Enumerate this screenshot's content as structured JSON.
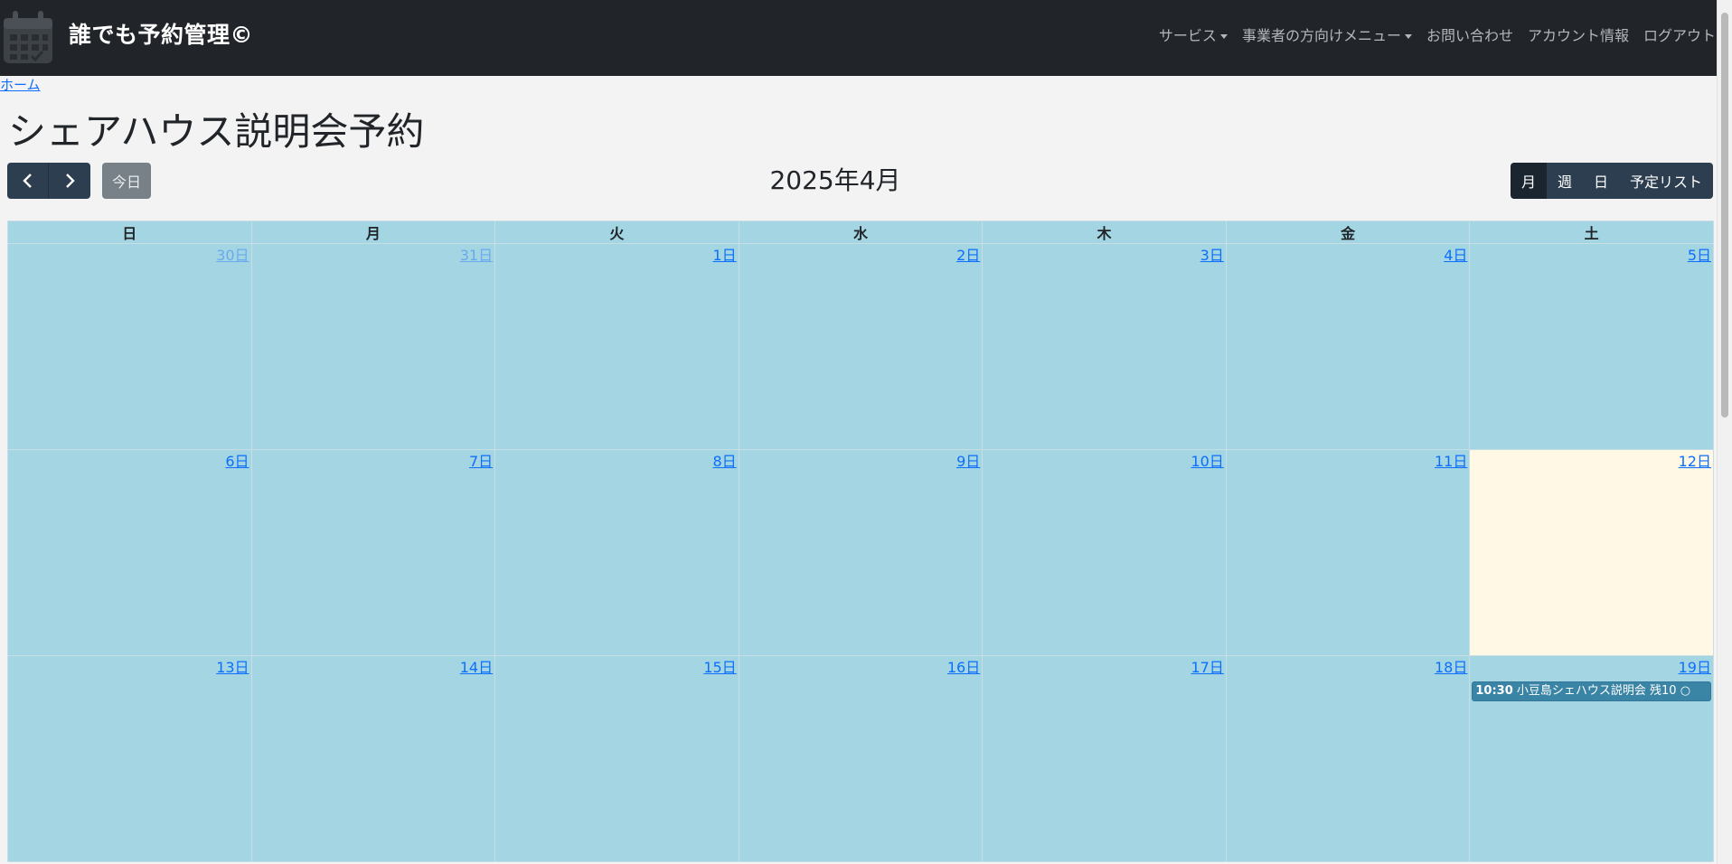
{
  "app": {
    "title": "誰でも予約管理©"
  },
  "nav": {
    "items": [
      {
        "label": "サービス",
        "dropdown": true
      },
      {
        "label": "事業者の方向けメニュー",
        "dropdown": true
      },
      {
        "label": "お問い合わせ",
        "dropdown": false
      },
      {
        "label": "アカウント情報",
        "dropdown": false
      },
      {
        "label": "ログアウト",
        "dropdown": false
      }
    ]
  },
  "breadcrumb": {
    "home": "ホーム"
  },
  "page": {
    "title": "シェアハウス説明会予約"
  },
  "toolbar": {
    "prev_icon": "chevron-left-icon",
    "next_icon": "chevron-right-icon",
    "today_label": "今日",
    "calendar_title": "2025年4月",
    "views": [
      "月",
      "週",
      "日",
      "予定リスト"
    ],
    "active_view": "月"
  },
  "calendar": {
    "weekdays": [
      "日",
      "月",
      "火",
      "水",
      "木",
      "金",
      "土"
    ],
    "weeks": [
      [
        {
          "label": "30日",
          "other": true
        },
        {
          "label": "31日",
          "other": true
        },
        {
          "label": "1日"
        },
        {
          "label": "2日"
        },
        {
          "label": "3日"
        },
        {
          "label": "4日"
        },
        {
          "label": "5日"
        }
      ],
      [
        {
          "label": "6日"
        },
        {
          "label": "7日"
        },
        {
          "label": "8日"
        },
        {
          "label": "9日"
        },
        {
          "label": "10日"
        },
        {
          "label": "11日"
        },
        {
          "label": "12日",
          "today": true
        }
      ],
      [
        {
          "label": "13日"
        },
        {
          "label": "14日"
        },
        {
          "label": "15日"
        },
        {
          "label": "16日"
        },
        {
          "label": "17日"
        },
        {
          "label": "18日"
        },
        {
          "label": "19日",
          "events": [
            {
              "time": "10:30",
              "title": "小豆島シェハウス説明会 残10 ○"
            }
          ]
        }
      ]
    ]
  },
  "colors": {
    "navbar": "#212529",
    "cell_bg": "#a3d6e2",
    "today_bg": "#fef8e4",
    "event_bg": "#3a85a6",
    "link": "#0d6efd",
    "button_dark": "#2c3e50"
  }
}
